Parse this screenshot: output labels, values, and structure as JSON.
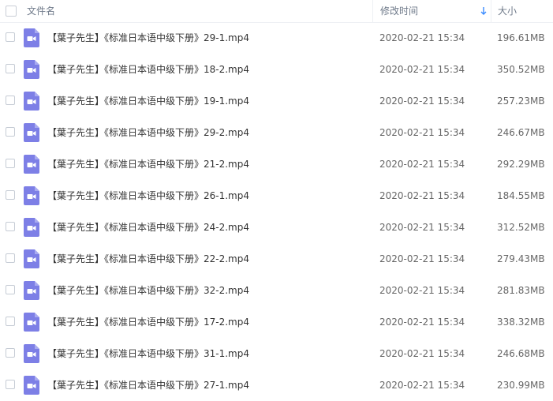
{
  "header": {
    "name_label": "文件名",
    "date_label": "修改时间",
    "size_label": "大小",
    "sort_icon": "sort-down-arrow-icon"
  },
  "colors": {
    "icon_bg": "#7d7fe6",
    "accent": "#3b8cff"
  },
  "files": [
    {
      "name": "【葉子先生】《标准日本语中级下册》29-1.mp4",
      "date": "2020-02-21 15:34",
      "size": "196.61MB"
    },
    {
      "name": "【葉子先生】《标准日本语中级下册》18-2.mp4",
      "date": "2020-02-21 15:34",
      "size": "350.52MB"
    },
    {
      "name": "【葉子先生】《标准日本语中级下册》19-1.mp4",
      "date": "2020-02-21 15:34",
      "size": "257.23MB"
    },
    {
      "name": "【葉子先生】《标准日本语中级下册》29-2.mp4",
      "date": "2020-02-21 15:34",
      "size": "246.67MB"
    },
    {
      "name": "【葉子先生】《标准日本语中级下册》21-2.mp4",
      "date": "2020-02-21 15:34",
      "size": "292.29MB"
    },
    {
      "name": "【葉子先生】《标准日本语中级下册》26-1.mp4",
      "date": "2020-02-21 15:34",
      "size": "184.55MB"
    },
    {
      "name": "【葉子先生】《标准日本语中级下册》24-2.mp4",
      "date": "2020-02-21 15:34",
      "size": "312.52MB"
    },
    {
      "name": "【葉子先生】《标准日本语中级下册》22-2.mp4",
      "date": "2020-02-21 15:34",
      "size": "279.43MB"
    },
    {
      "name": "【葉子先生】《标准日本语中级下册》32-2.mp4",
      "date": "2020-02-21 15:34",
      "size": "281.83MB"
    },
    {
      "name": "【葉子先生】《标准日本语中级下册》17-2.mp4",
      "date": "2020-02-21 15:34",
      "size": "338.32MB"
    },
    {
      "name": "【葉子先生】《标准日本语中级下册》31-1.mp4",
      "date": "2020-02-21 15:34",
      "size": "246.68MB"
    },
    {
      "name": "【葉子先生】《标准日本语中级下册》27-1.mp4",
      "date": "2020-02-21 15:34",
      "size": "230.99MB"
    }
  ]
}
